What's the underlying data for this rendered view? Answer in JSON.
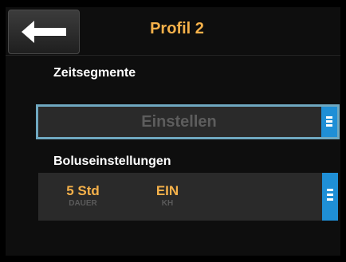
{
  "header": {
    "title": "Profil 2",
    "back_icon": "back-arrow-icon"
  },
  "zeitsegmente": {
    "label": "Zeitsegmente",
    "value": "Einstellen"
  },
  "boluseinstellungen": {
    "label": "Boluseinstellungen",
    "duration_value": "5 Std",
    "duration_caption": "DAUER",
    "kh_value": "EIN",
    "kh_caption": "KH"
  },
  "colors": {
    "accent": "#f5b14a",
    "selection_border": "#6fa8c0",
    "scroll_handle": "#1f8fd6"
  }
}
